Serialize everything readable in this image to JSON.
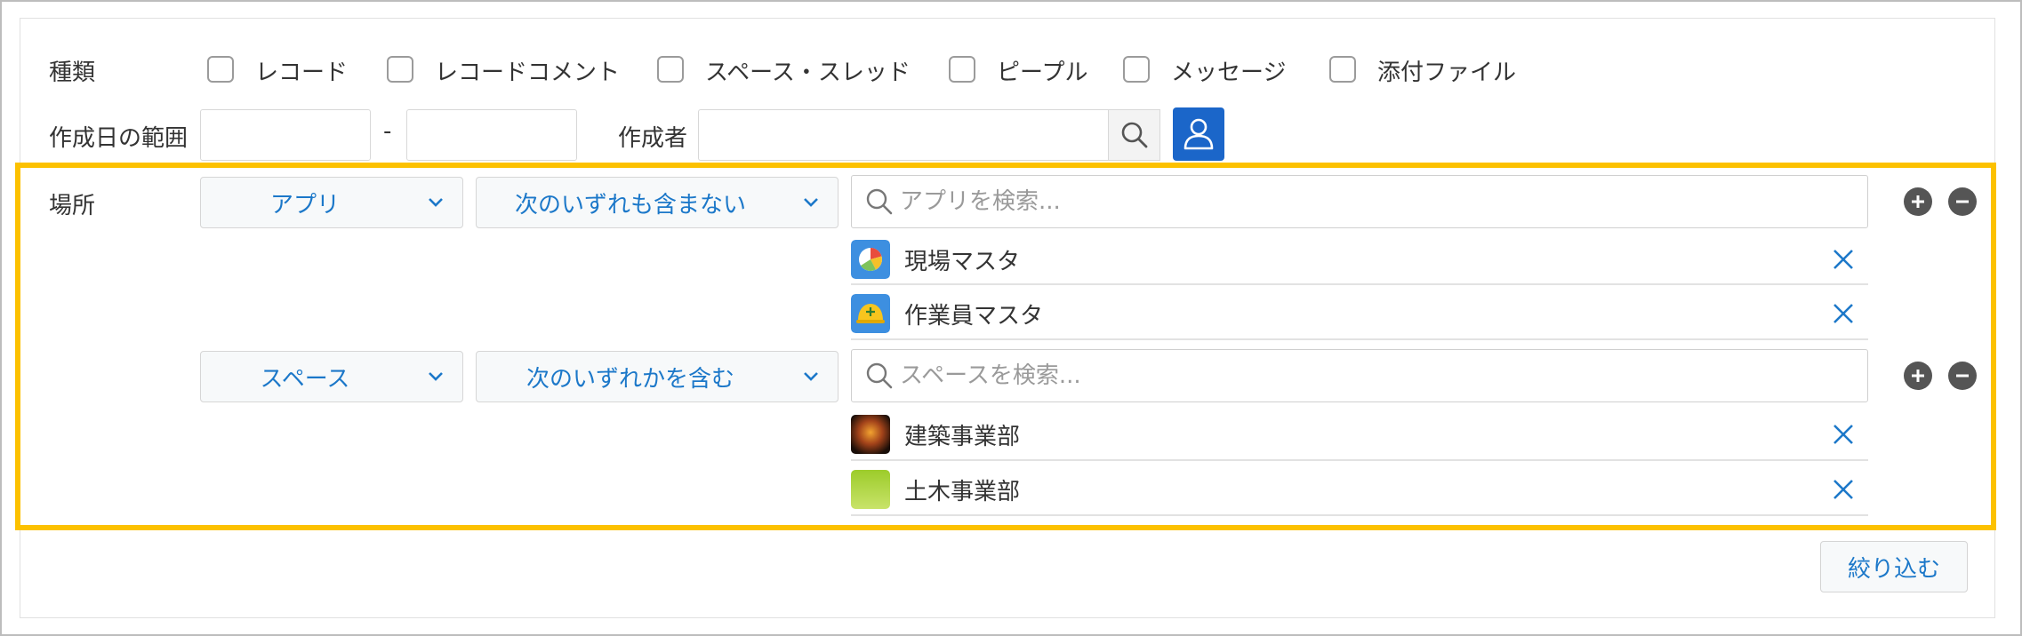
{
  "type_row": {
    "label": "種類",
    "options": [
      {
        "label": "レコード",
        "checked": false
      },
      {
        "label": "レコードコメント",
        "checked": false
      },
      {
        "label": "スペース・スレッド",
        "checked": false
      },
      {
        "label": "ピープル",
        "checked": false
      },
      {
        "label": "メッセージ",
        "checked": false
      },
      {
        "label": "添付ファイル",
        "checked": false
      }
    ]
  },
  "date_row": {
    "label": "作成日の範囲",
    "from_value": "",
    "separator": "-",
    "to_value": "",
    "creator_label": "作成者",
    "creator_value": ""
  },
  "location": {
    "label": "場所",
    "highlight_color": "#fcc100",
    "conditions": [
      {
        "target": "アプリ",
        "operator": "次のいずれも含まない",
        "search_placeholder": "アプリを検索...",
        "items": [
          {
            "name": "現場マスタ",
            "icon": "pie-chart-app-icon"
          },
          {
            "name": "作業員マスタ",
            "icon": "helmet-app-icon"
          }
        ]
      },
      {
        "target": "スペース",
        "operator": "次のいずれかを含む",
        "search_placeholder": "スペースを検索...",
        "items": [
          {
            "name": "建築事業部",
            "icon": "space-cover-dark-icon"
          },
          {
            "name": "土木事業部",
            "icon": "space-cover-green-icon"
          }
        ]
      }
    ]
  },
  "filter_button": "絞り込む",
  "colors": {
    "accent": "#1c78c9",
    "button_blue": "#1b66c9"
  }
}
